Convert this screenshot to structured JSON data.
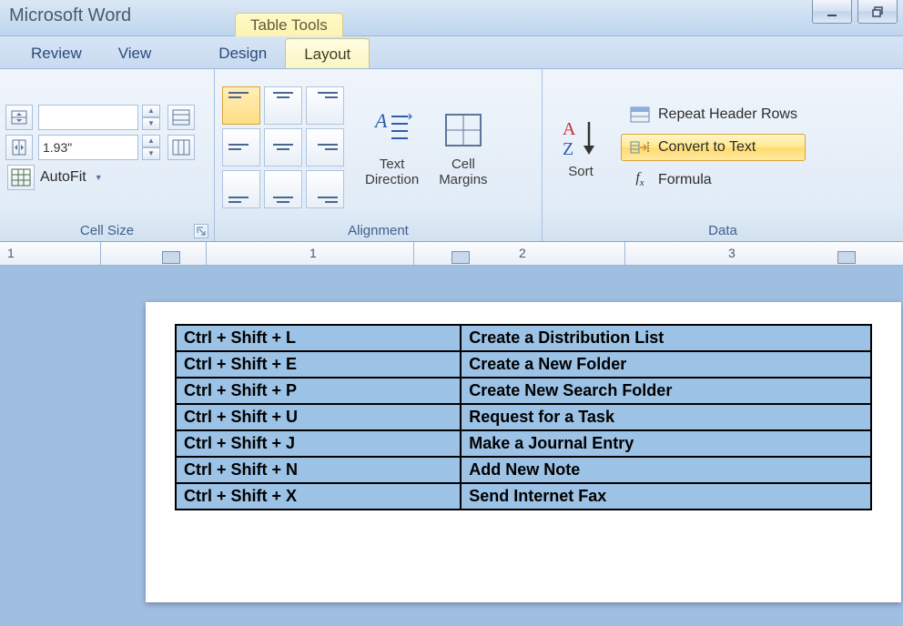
{
  "title_bar": {
    "app_name": "Microsoft Word",
    "context_tab": "Table Tools"
  },
  "tabs": {
    "review": "Review",
    "view": "View",
    "design": "Design",
    "layout": "Layout"
  },
  "ribbon": {
    "cell_size": {
      "label": "Cell Size",
      "height_value": "",
      "width_value": "1.93\"",
      "autofit": "AutoFit"
    },
    "alignment": {
      "label": "Alignment",
      "text_direction": "Text\nDirection",
      "cell_margins": "Cell\nMargins"
    },
    "data": {
      "label": "Data",
      "sort": "Sort",
      "repeat_header": "Repeat Header Rows",
      "convert_to_text": "Convert to Text",
      "formula": "Formula"
    }
  },
  "ruler": {
    "marks": [
      "1",
      "1",
      "2",
      "3"
    ]
  },
  "table_rows": [
    {
      "shortcut": "Ctrl + Shift + L",
      "action": " Create a Distribution List"
    },
    {
      "shortcut": "Ctrl + Shift + E",
      "action": "Create a New Folder"
    },
    {
      "shortcut": "Ctrl + Shift + P",
      "action": "Create New Search Folder"
    },
    {
      "shortcut": "Ctrl + Shift + U",
      "action": "Request for a Task"
    },
    {
      "shortcut": "Ctrl + Shift + J",
      "action": " Make a Journal Entry"
    },
    {
      "shortcut": "Ctrl + Shift + N",
      "action": "Add New Note"
    },
    {
      "shortcut": "Ctrl + Shift + X",
      "action": "Send Internet Fax"
    }
  ]
}
